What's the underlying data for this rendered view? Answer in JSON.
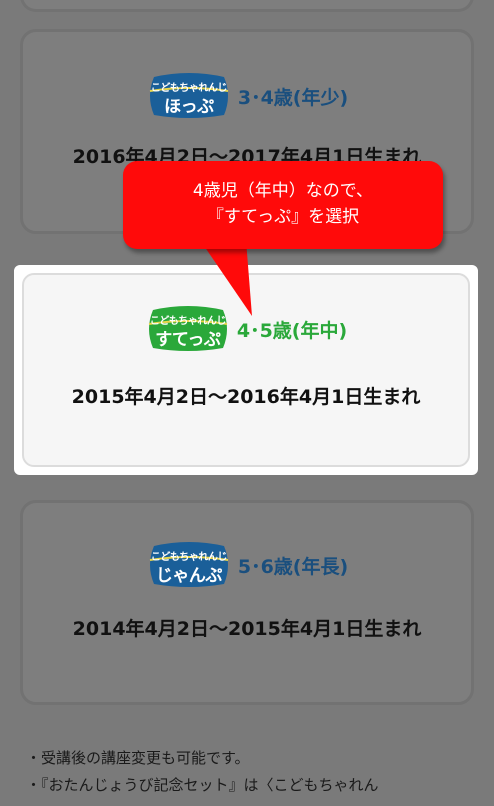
{
  "cards": [
    {
      "logo_top": "こどもちゃれんじ",
      "logo_name": "ほっぷ",
      "age": "3･4歳(年少)",
      "dates": "2016年4月2日～2017年4月1日生まれ",
      "logo_color": "#1a6fb3",
      "age_color": "#1a4f7e"
    },
    {
      "logo_top": "こどもちゃれんじ",
      "logo_name": "すてっぷ",
      "age": "4･5歳(年中)",
      "dates": "2015年4月2日～2016年4月1日生まれ",
      "logo_color": "#2aa83a",
      "age_color": "#2aa83a"
    },
    {
      "logo_top": "こどもちゃれんじ",
      "logo_name": "じゃんぷ",
      "age": "5･6歳(年長)",
      "dates": "2014年4月2日～2015年4月1日生まれ",
      "logo_color": "#1a6fb3",
      "age_color": "#1a4f7e"
    }
  ],
  "callout": {
    "line1": "4歳児（年中）なので、",
    "line2": "『すてっぷ』を選択",
    "color": "#ff0a0a"
  },
  "notes": [
    "・受講後の講座変更も可能です。",
    "・『おたんじょうび記念セット』は〈こどもちゃれん"
  ]
}
